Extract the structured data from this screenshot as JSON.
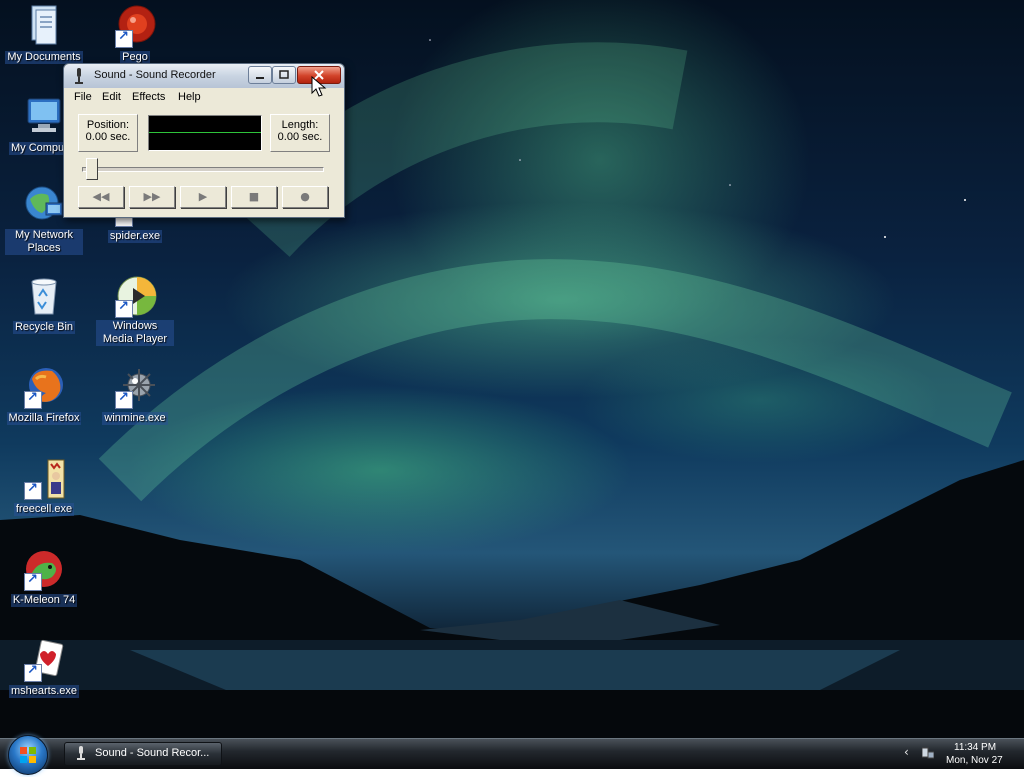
{
  "desktop": {
    "icons": [
      {
        "label": "My Documents"
      },
      {
        "label": "Pego"
      },
      {
        "label": "My Computer"
      },
      {
        "label": "My Network Places"
      },
      {
        "label": "spider.exe"
      },
      {
        "label": "Recycle Bin"
      },
      {
        "label": "Windows Media Player"
      },
      {
        "label": "Mozilla Firefox"
      },
      {
        "label": "winmine.exe"
      },
      {
        "label": "freecell.exe"
      },
      {
        "label": "K-Meleon 74"
      },
      {
        "label": "mshearts.exe"
      }
    ]
  },
  "window": {
    "title": "Sound - Sound Recorder",
    "menu": [
      "File",
      "Edit",
      "Effects",
      "Help"
    ],
    "position_label": "Position:",
    "position_value": "0.00 sec.",
    "length_label": "Length:",
    "length_value": "0.00 sec.",
    "controls": {
      "rewind": "◀◀",
      "fast_forward": "▶▶",
      "play": "▶",
      "stop": "■",
      "record": "●"
    }
  },
  "taskbar": {
    "task_label": "Sound - Sound Recor...",
    "chevron": "‹",
    "time": "11:34 PM",
    "date": "Mon, Nov 27"
  },
  "colors": {
    "waveform_line": "#2ec43a",
    "close_button": "#d2432a"
  }
}
